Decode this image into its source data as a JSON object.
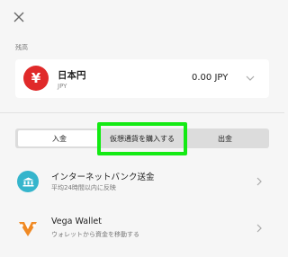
{
  "header": {
    "close_icon": "close-icon"
  },
  "balance": {
    "section_label": "残高",
    "currency_symbol": "¥",
    "currency_name": "日本円",
    "currency_code": "JPY",
    "amount": "0.00 JPY",
    "icon_color": "#e02a2a"
  },
  "tabs": [
    {
      "label": "入金",
      "selected": true
    },
    {
      "label": "仮想通貨を購入する",
      "selected": false
    },
    {
      "label": "出金",
      "selected": false
    }
  ],
  "highlight_color": "#13ea13",
  "options": [
    {
      "title": "インターネットバンク送金",
      "subtitle": "平均24時間以内に反映",
      "icon": "bank-icon",
      "icon_color": "#35b5cc"
    },
    {
      "title": "Vega Wallet",
      "subtitle": "ウォレットから資金を移動する",
      "icon": "vega-wallet-icon",
      "icon_color": "#f08a24"
    }
  ]
}
